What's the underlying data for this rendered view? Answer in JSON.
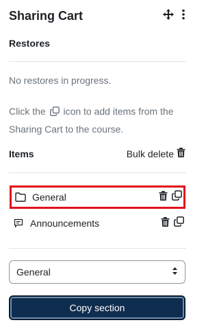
{
  "block": {
    "title": "Sharing Cart",
    "move_icon": "move-icon",
    "menu_icon": "kebab-menu-icon"
  },
  "restores": {
    "heading": "Restores",
    "status": "No restores in progress."
  },
  "help": {
    "before_icon": "Click the",
    "after_icon": "icon to add items from the Sharing Cart to the course."
  },
  "items": {
    "heading": "Items",
    "bulk_delete": "Bulk delete",
    "list": [
      {
        "name": "General",
        "icon": "folder-icon",
        "highlighted": true
      },
      {
        "name": "Announcements",
        "icon": "forum-icon",
        "highlighted": false
      }
    ]
  },
  "section_select": {
    "value": "General"
  },
  "copy_button": {
    "label": "Copy section"
  },
  "colors": {
    "highlight": "#e0111b",
    "button_bg": "#0f2d4e"
  }
}
